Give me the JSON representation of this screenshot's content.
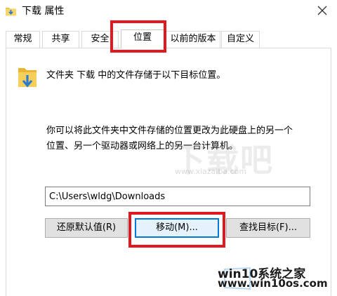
{
  "window": {
    "title": "下载 属性"
  },
  "tabs": [
    {
      "label": "常规"
    },
    {
      "label": "共享"
    },
    {
      "label": "安全"
    },
    {
      "label": "位置",
      "active": true
    },
    {
      "label": "以前的版本"
    },
    {
      "label": "自定义"
    }
  ],
  "location": {
    "description": "文件夹 下载 中的文件存储于以下目标位置。",
    "explanation": "你可以将此文件夹中文件存储的位置更改为此硬盘上的另一个位置、另一个驱动器或网络上的另一台计算机。",
    "path_value": "C:\\Users\\wldg\\Downloads"
  },
  "buttons": {
    "restore_default": "还原默认值(R)",
    "move": "移动(M)...",
    "find_target": "查找目标(F)..."
  },
  "watermark": {
    "big": "下载吧",
    "small": "www.xiazaiba.com"
  },
  "brand": {
    "line1": "win10系统之家",
    "line2": "www.win10os.com"
  },
  "colors": {
    "highlight": "#e0191f",
    "focus": "#0078d7",
    "folder": "#f3c443",
    "arrow": "#2b7bd3"
  }
}
